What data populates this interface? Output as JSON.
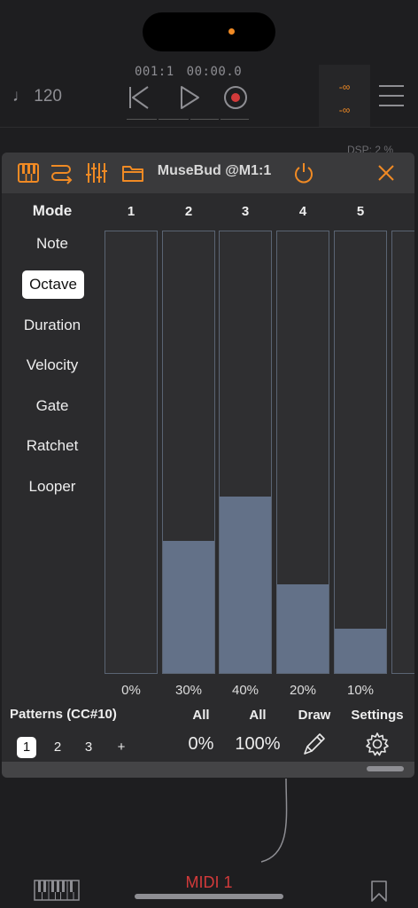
{
  "host": {
    "tempo": "♩ 120",
    "position_bars": "001:1",
    "position_time": "00:00.0",
    "meter_top": "-∞",
    "meter_bottom": "-∞",
    "dsp": "DSP: 2 %",
    "track_name": "MIDI 1",
    "accent_color": "#f08a24",
    "record_color": "#d23a3a"
  },
  "plugin": {
    "title": "MuseBud @M1:1",
    "header_icons": [
      "piano-keys-icon",
      "routing-icon",
      "mixer-sliders-icon",
      "folder-icon",
      "power-icon",
      "close-icon"
    ],
    "mode_label": "Mode",
    "modes": [
      "Note",
      "Octave",
      "Duration",
      "Velocity",
      "Gate",
      "Ratchet",
      "Looper"
    ],
    "active_mode": "Octave",
    "steps": [
      {
        "label": "1",
        "value": 0,
        "display": "0%"
      },
      {
        "label": "2",
        "value": 30,
        "display": "30%"
      },
      {
        "label": "3",
        "value": 40,
        "display": "40%"
      },
      {
        "label": "4",
        "value": 20,
        "display": "20%"
      },
      {
        "label": "5",
        "value": 10,
        "display": "10%"
      }
    ],
    "patterns_label": "Patterns (CC#10)",
    "patterns": [
      "1",
      "2",
      "3",
      "+"
    ],
    "active_pattern": "1",
    "footer": {
      "all_min_label": "All",
      "all_min_value": "0%",
      "all_max_label": "All",
      "all_max_value": "100%",
      "draw_label": "Draw",
      "settings_label": "Settings"
    }
  }
}
